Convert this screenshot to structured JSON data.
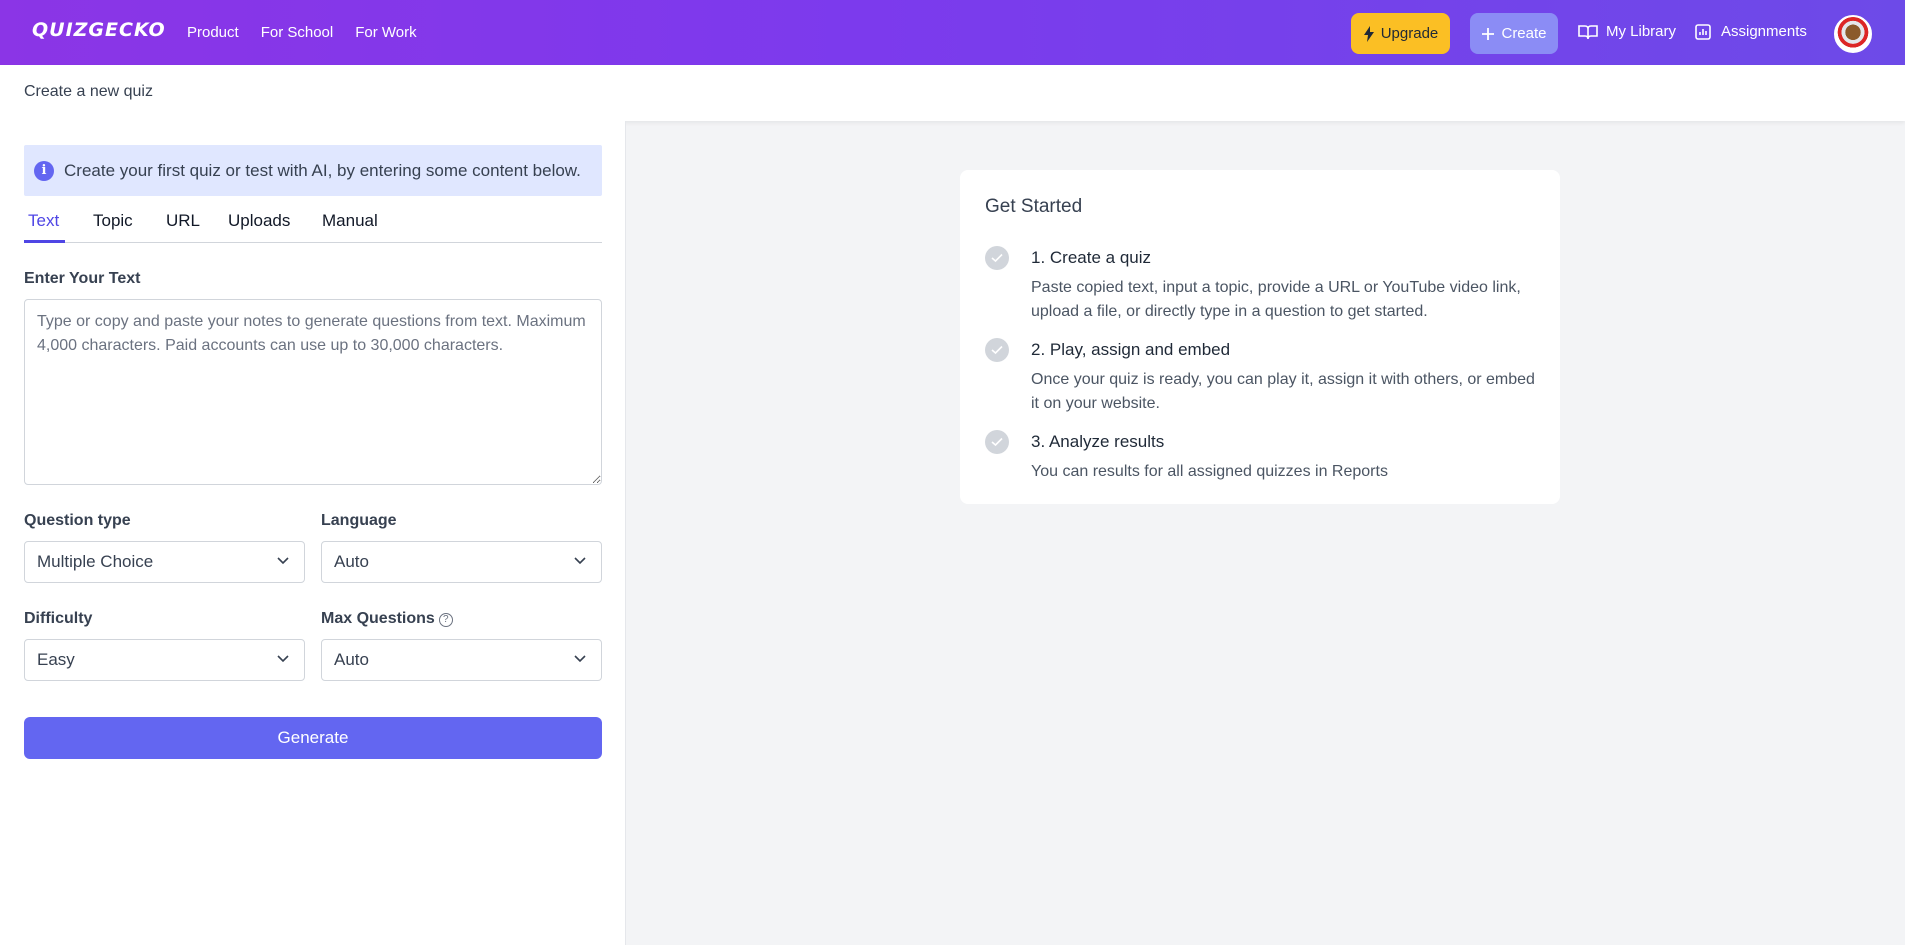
{
  "nav": {
    "logo": "QUIZGECKO",
    "links": [
      "Product",
      "For School",
      "For Work"
    ],
    "upgrade_label": "Upgrade",
    "create_label": "Create",
    "library_label": "My Library",
    "assignments_label": "Assignments",
    "colors": {
      "upgrade": "#fbbf24",
      "create": "#8b8cf5",
      "brand": "#7c3aed"
    }
  },
  "subheader": {
    "title": "Create a new quiz"
  },
  "form": {
    "info_text": "Create your first quiz or test with AI, by entering some content below.",
    "tabs": [
      "Text",
      "Topic",
      "URL",
      "Uploads",
      "Manual"
    ],
    "active_tab": "Text",
    "text_label": "Enter Your Text",
    "text_placeholder": "Type or copy and paste your notes to generate questions from text. Maximum 4,000 characters. Paid accounts can use up to 30,000 characters.",
    "text_value": "",
    "question_type_label": "Question type",
    "question_type_value": "Multiple Choice",
    "language_label": "Language",
    "language_value": "Auto",
    "difficulty_label": "Difficulty",
    "difficulty_value": "Easy",
    "max_questions_label": "Max Questions",
    "max_questions_value": "Auto",
    "generate_label": "Generate",
    "accent": "#6366f1"
  },
  "get_started": {
    "title": "Get Started",
    "steps": [
      {
        "title": "1. Create a quiz",
        "desc": "Paste copied text, input a topic, provide a URL or YouTube video link, upload a file, or directly type in a question to get started."
      },
      {
        "title": "2. Play, assign and embed",
        "desc": "Once your quiz is ready, you can play it, assign it with others, or embed it on your website."
      },
      {
        "title": "3. Analyze results",
        "desc": "You can results for all assigned quizzes in Reports"
      }
    ]
  }
}
